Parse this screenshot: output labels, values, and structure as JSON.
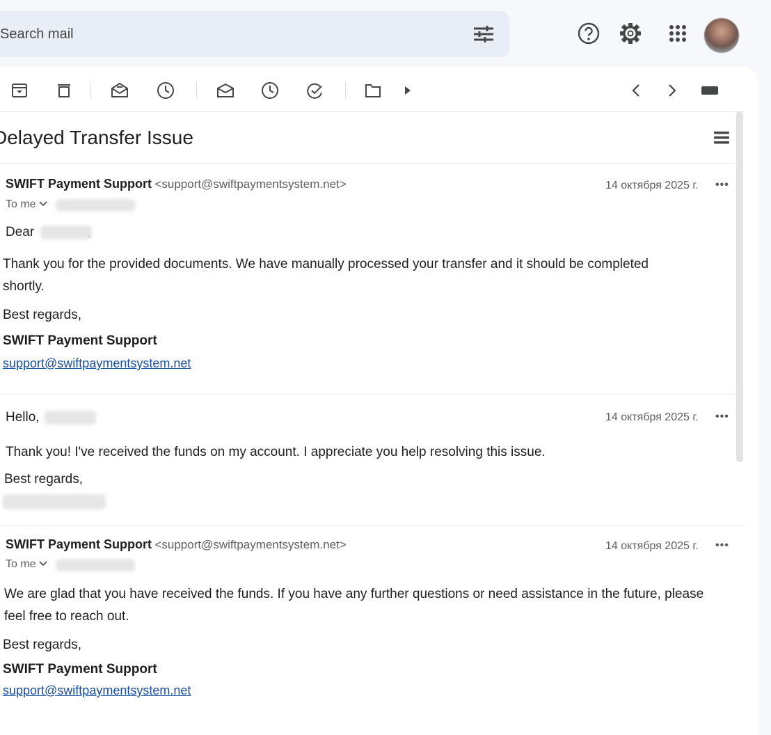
{
  "search": {
    "placeholder": "Search mail"
  },
  "top_icons": [
    "search-options-icon",
    "help-icon",
    "settings-icon",
    "apps-icon",
    "avatar"
  ],
  "toolbar": {
    "icons": [
      "archive-icon",
      "delete-icon",
      "mark-unread-icon",
      "snooze-icon",
      "move-to-inbox-icon",
      "clock-icon",
      "add-task-icon",
      "folder-icon",
      "more-arrow-icon",
      "prev-icon",
      "next-icon",
      "input-tools-icon"
    ]
  },
  "thread": {
    "subject": "Delayed Transfer Issue",
    "messages": [
      {
        "sender_name": "SWIFT Payment Support",
        "sender_email": "<support@swiftpaymentsystem.net>",
        "date": "14 октября 2025 г.",
        "to": "To me",
        "greeting": "Dear",
        "greeting_comma": ",",
        "body": "Thank you for the provided documents. We have manually processed your transfer and it should be completed shortly.",
        "closing": "Best regards,",
        "signature": "SWIFT Payment Support",
        "link": "support@swiftpaymentsystem.net"
      },
      {
        "greeting": "Hello,",
        "date": "14 октября 2025 г.",
        "body": "Thank you! I've received the funds on my account. I appreciate you help resolving this issue.",
        "closing": "Best regards,"
      },
      {
        "sender_name": "SWIFT Payment Support",
        "sender_email": "<support@swiftpaymentsystem.net>",
        "date": "14 октября 2025 г.",
        "to": "To me",
        "body": "We are glad that you have received the funds. If you have any further questions or need assistance in the future, please feel free to reach out.",
        "closing": "Best regards,",
        "signature": "SWIFT Payment Support",
        "link": "support@swiftpaymentsystem.net"
      }
    ]
  },
  "more_label": "•••",
  "colors": {
    "background": "#f6f8fc",
    "search_bg": "#e9eef6",
    "link": "#1a4fa0"
  }
}
